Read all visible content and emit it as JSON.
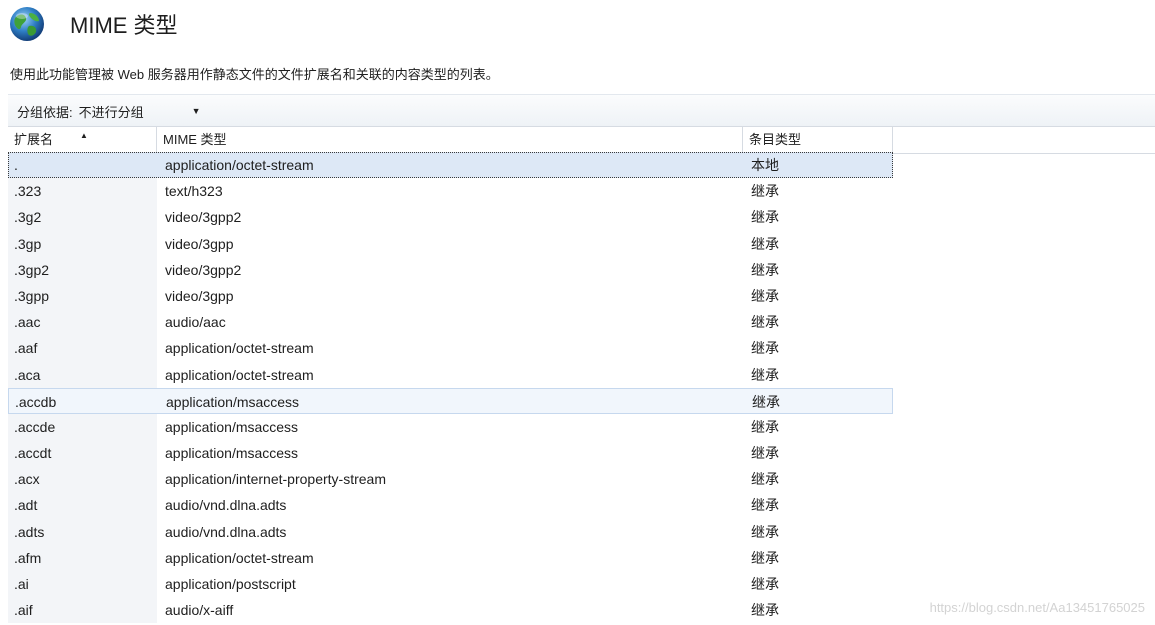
{
  "header": {
    "title": "MIME 类型",
    "icon": "globe-icon"
  },
  "description": "使用此功能管理被 Web 服务器用作静态文件的文件扩展名和关联的内容类型的列表。",
  "toolbar": {
    "group_label": "分组依据:",
    "group_value": "不进行分组"
  },
  "columns": {
    "extension": "扩展名",
    "mime": "MIME 类型",
    "entry_type": "条目类型"
  },
  "rows": [
    {
      "ext": ".",
      "mime": "application/octet-stream",
      "type": "本地"
    },
    {
      "ext": ".323",
      "mime": "text/h323",
      "type": "继承"
    },
    {
      "ext": ".3g2",
      "mime": "video/3gpp2",
      "type": "继承"
    },
    {
      "ext": ".3gp",
      "mime": "video/3gpp",
      "type": "继承"
    },
    {
      "ext": ".3gp2",
      "mime": "video/3gpp2",
      "type": "继承"
    },
    {
      "ext": ".3gpp",
      "mime": "video/3gpp",
      "type": "继承"
    },
    {
      "ext": ".aac",
      "mime": "audio/aac",
      "type": "继承"
    },
    {
      "ext": ".aaf",
      "mime": "application/octet-stream",
      "type": "继承"
    },
    {
      "ext": ".aca",
      "mime": "application/octet-stream",
      "type": "继承"
    },
    {
      "ext": ".accdb",
      "mime": "application/msaccess",
      "type": "继承"
    },
    {
      "ext": ".accde",
      "mime": "application/msaccess",
      "type": "继承"
    },
    {
      "ext": ".accdt",
      "mime": "application/msaccess",
      "type": "继承"
    },
    {
      "ext": ".acx",
      "mime": "application/internet-property-stream",
      "type": "继承"
    },
    {
      "ext": ".adt",
      "mime": "audio/vnd.dlna.adts",
      "type": "继承"
    },
    {
      "ext": ".adts",
      "mime": "audio/vnd.dlna.adts",
      "type": "继承"
    },
    {
      "ext": ".afm",
      "mime": "application/octet-stream",
      "type": "继承"
    },
    {
      "ext": ".ai",
      "mime": "application/postscript",
      "type": "继承"
    },
    {
      "ext": ".aif",
      "mime": "audio/x-aiff",
      "type": "继承"
    }
  ],
  "watermark": "https://blog.csdn.net/Aa13451765025"
}
